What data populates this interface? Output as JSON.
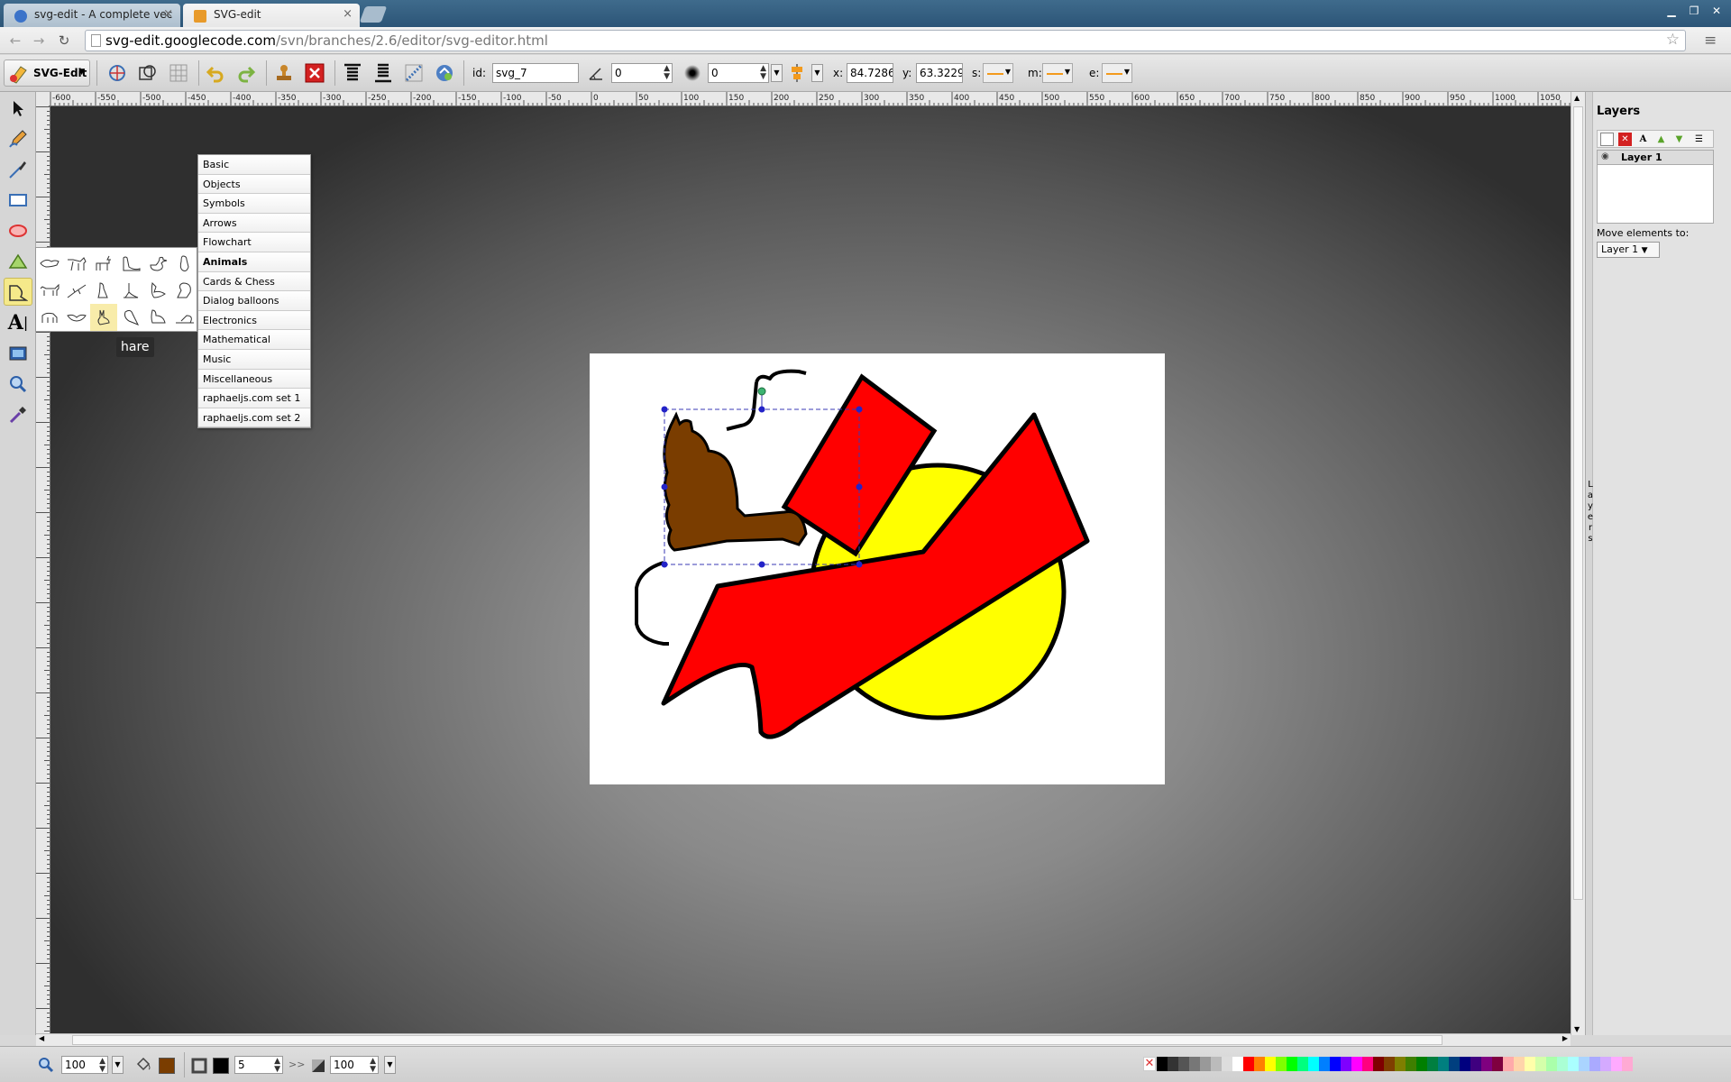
{
  "browser": {
    "tabs": [
      {
        "title": "svg-edit - A complete vec"
      },
      {
        "title": "SVG-edit"
      }
    ],
    "url_host": "svg-edit.googlecode.com",
    "url_path": "/svn/branches/2.6/editor/svg-editor.html"
  },
  "toolbar": {
    "app_name": "SVG-Edit",
    "id_label": "id:",
    "id_value": "svg_7",
    "angle_value": "0",
    "blur_value": "0",
    "x_label": "x:",
    "x_value": "84.72863",
    "y_label": "y:",
    "y_value": "63.32293",
    "s_label": "s:",
    "m_label": "m:",
    "e_label": "e:"
  },
  "shape_library": {
    "categories": [
      "Basic",
      "Objects",
      "Symbols",
      "Arrows",
      "Flowchart",
      "Animals",
      "Cards & Chess",
      "Dialog balloons",
      "Electronics",
      "Mathematical",
      "Music",
      "Miscellaneous",
      "raphaeljs.com set 1",
      "raphaeljs.com set 2"
    ],
    "current": "Animals",
    "tooltip": "hare"
  },
  "ruler": {
    "top_ticks": [
      "-600",
      "-550",
      "-500",
      "-450",
      "-400",
      "-350",
      "-300",
      "-250",
      "-200",
      "-150",
      "-100",
      "-50",
      "0",
      "50",
      "100",
      "150",
      "200",
      "250",
      "300",
      "350",
      "400",
      "450",
      "500",
      "550",
      "600",
      "650",
      "700",
      "750",
      "800",
      "850",
      "900",
      "950",
      "1000",
      "1050"
    ]
  },
  "layers": {
    "title": "Layers",
    "items": [
      "Layer 1"
    ],
    "handle_label": "Layers",
    "move_label": "Move elements to:",
    "move_value": "Layer 1"
  },
  "bottom": {
    "zoom": "100",
    "stroke_width": "5",
    "opacity": "100",
    "chevrons": ">>",
    "fill_color": "#7a3d00",
    "stroke_color": "#000000"
  },
  "palette": [
    "#000000",
    "#333333",
    "#555555",
    "#777777",
    "#999999",
    "#bbbbbb",
    "#dddddd",
    "#ffffff",
    "#ff0000",
    "#ff7f00",
    "#ffff00",
    "#7fff00",
    "#00ff00",
    "#00ff7f",
    "#00ffff",
    "#007fff",
    "#0000ff",
    "#7f00ff",
    "#ff00ff",
    "#ff007f",
    "#7f0000",
    "#7f3f00",
    "#7f7f00",
    "#3f7f00",
    "#007f00",
    "#007f3f",
    "#007f7f",
    "#003f7f",
    "#00007f",
    "#3f007f",
    "#7f007f",
    "#7f003f",
    "#ffaaaa",
    "#ffd4aa",
    "#ffffaa",
    "#d4ffaa",
    "#aaffaa",
    "#aaffd4",
    "#aaffff",
    "#aad4ff",
    "#aaaaff",
    "#d4aaff",
    "#ffaaff",
    "#ffaad4"
  ]
}
